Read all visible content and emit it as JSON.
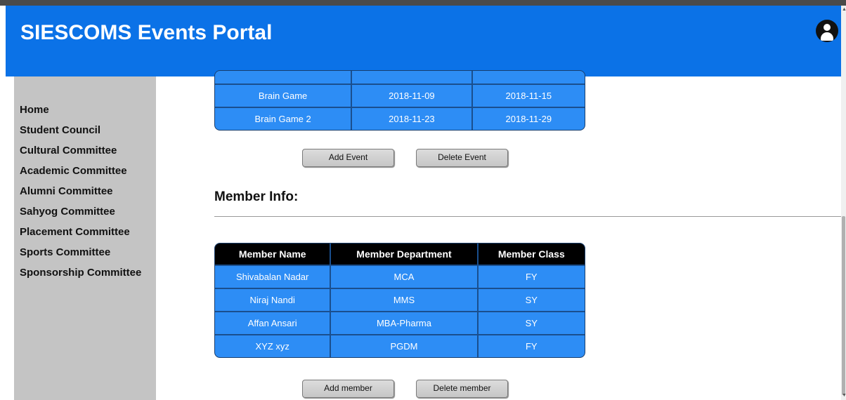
{
  "header": {
    "title": "SIESCOMS Events Portal",
    "avatar_icon": "user-avatar-icon"
  },
  "sidebar": {
    "items": [
      {
        "label": "Home"
      },
      {
        "label": "Student Council"
      },
      {
        "label": "Cultural Committee"
      },
      {
        "label": "Academic Committee"
      },
      {
        "label": "Alumni Committee"
      },
      {
        "label": "Sahyog Committee"
      },
      {
        "label": "Placement Committee"
      },
      {
        "label": "Sports Committee"
      },
      {
        "label": "Sponsorship Committee"
      }
    ]
  },
  "events": {
    "rows": [
      {
        "name": "Brain Game",
        "start": "2018-11-09",
        "end": "2018-11-15"
      },
      {
        "name": "Brain Game 2",
        "start": "2018-11-23",
        "end": "2018-11-29"
      }
    ],
    "add_label": "Add Event",
    "delete_label": "Delete Event"
  },
  "members": {
    "heading": "Member Info:",
    "columns": [
      "Member Name",
      "Member Department",
      "Member Class"
    ],
    "rows": [
      {
        "name": "Shivabalan Nadar",
        "department": "MCA",
        "class": "FY"
      },
      {
        "name": "Niraj Nandi",
        "department": "MMS",
        "class": "SY"
      },
      {
        "name": "Affan Ansari",
        "department": "MBA-Pharma",
        "class": "SY"
      },
      {
        "name": "XYZ xyz",
        "department": "PGDM",
        "class": "FY"
      }
    ],
    "add_label": "Add member",
    "delete_label": "Delete member"
  },
  "colors": {
    "header": "#0b72e7",
    "table": "#2d8df5",
    "sidebar": "#c4c4c4"
  }
}
